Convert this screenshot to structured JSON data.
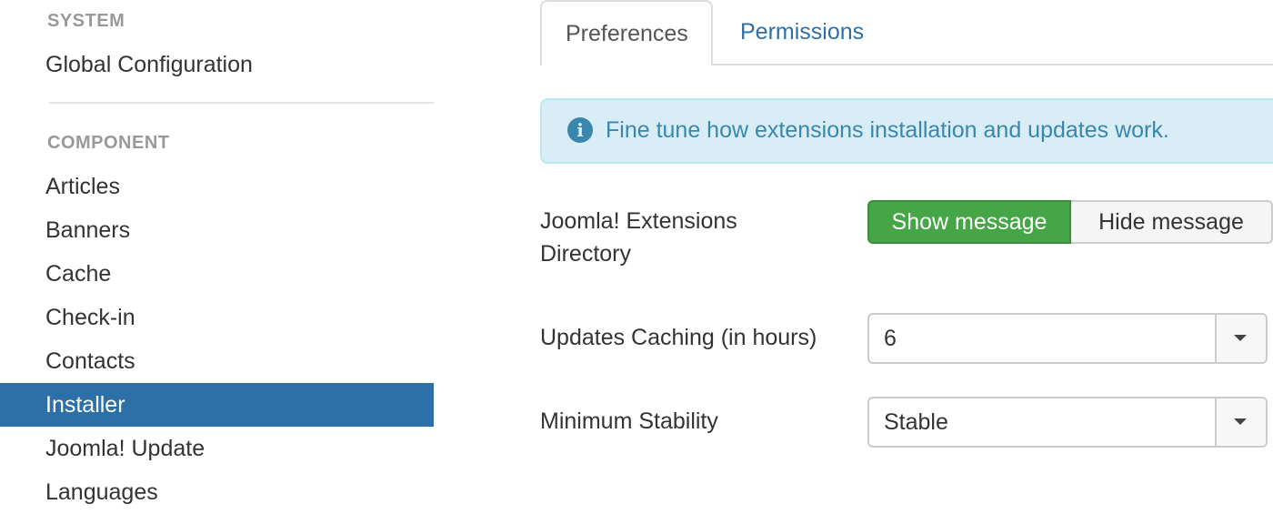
{
  "sidebar": {
    "system_header": "SYSTEM",
    "system_items": [
      {
        "label": "Global Configuration"
      }
    ],
    "component_header": "COMPONENT",
    "component_items": [
      {
        "label": "Articles"
      },
      {
        "label": "Banners"
      },
      {
        "label": "Cache"
      },
      {
        "label": "Check-in"
      },
      {
        "label": "Contacts"
      },
      {
        "label": "Installer",
        "active": true
      },
      {
        "label": "Joomla! Update"
      },
      {
        "label": "Languages"
      }
    ]
  },
  "tabs": [
    {
      "label": "Preferences",
      "active": true
    },
    {
      "label": "Permissions",
      "active": false
    }
  ],
  "alert": {
    "icon": "info-icon",
    "text": "Fine tune how extensions installation and updates work."
  },
  "form": {
    "jed": {
      "label_line1": "Joomla! Extensions",
      "label_line2": "Directory",
      "show_label": "Show message",
      "hide_label": "Hide message",
      "selected": "Show message"
    },
    "cache": {
      "label": "Updates Caching (in hours)",
      "value": "6"
    },
    "stability": {
      "label": "Minimum Stability",
      "value": "Stable"
    }
  },
  "colors": {
    "accent": "#2d6fa7",
    "success": "#46a546",
    "info_bg": "#d9edf7",
    "info_text": "#3a87ad"
  }
}
